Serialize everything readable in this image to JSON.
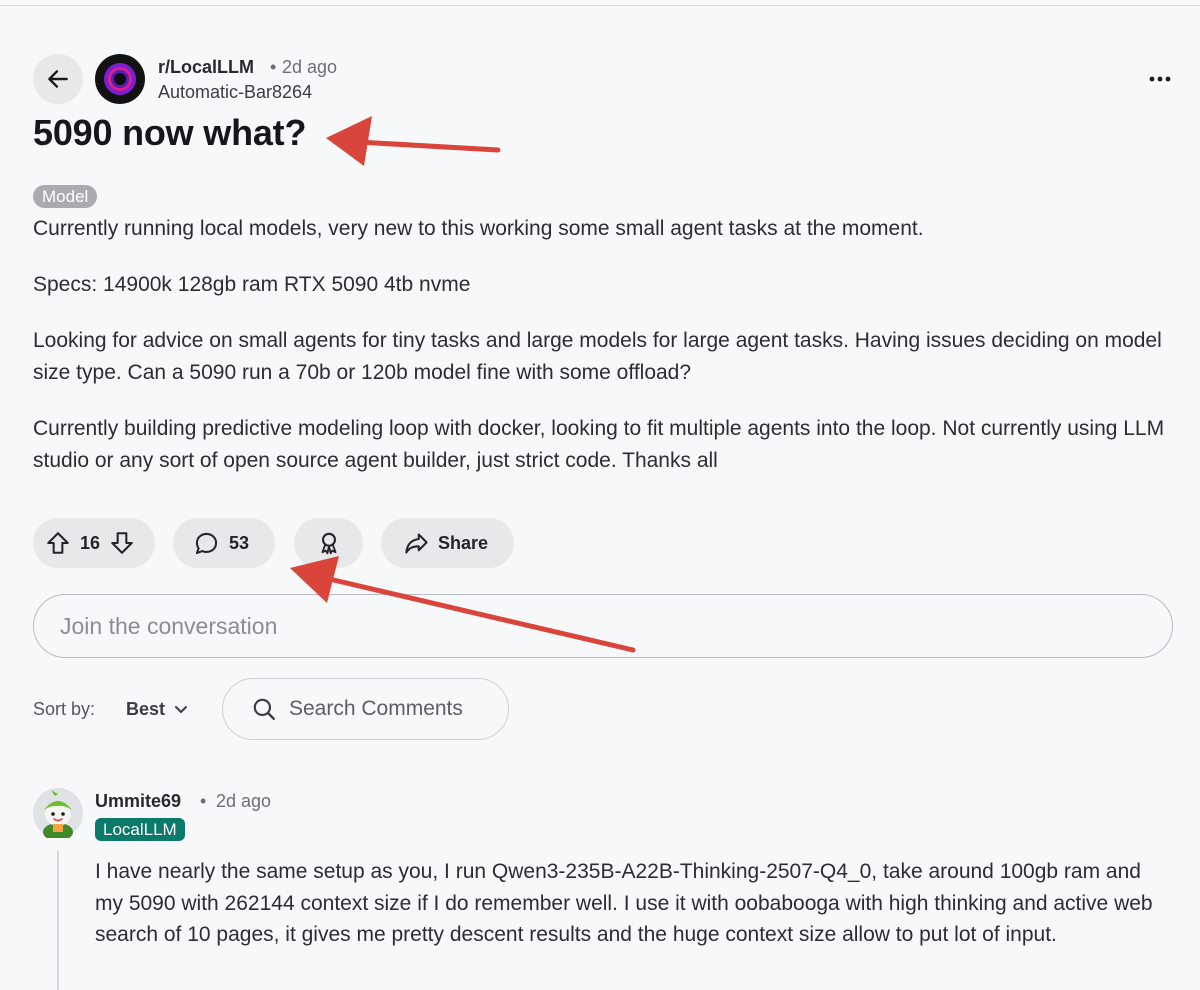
{
  "post": {
    "subreddit": "r/LocalLLM",
    "separator": "•",
    "age": "2d ago",
    "author": "Automatic-Bar8264",
    "title": "5090 now what?",
    "flair": "Model",
    "paragraphs": [
      "Currently running local models, very new to this working some small agent tasks at the moment.",
      "Specs: 14900k 128gb ram RTX 5090 4tb nvme",
      "Looking for advice on small agents for tiny tasks and large models for large agent tasks. Having issues deciding on model size type. Can a 5090 run a 70b or 120b model fine with some offload?",
      "Currently building predictive modeling loop with docker, looking to fit multiple agents into the loop. Not currently using LLM studio or any sort of open source agent builder, just strict code. Thanks all"
    ]
  },
  "actions": {
    "vote_count": "16",
    "comment_count": "53",
    "share_label": "Share"
  },
  "composer": {
    "placeholder": "Join the conversation"
  },
  "sort": {
    "label": "Sort by:",
    "value": "Best"
  },
  "search": {
    "placeholder": "Search Comments"
  },
  "comment": {
    "author": "Ummite69",
    "separator": "•",
    "age": "2d ago",
    "flair": "LocalLLM",
    "flair_color": "#0b7a6a",
    "text": "I have nearly the same setup as you, I run Qwen3-235B-A22B-Thinking-2507-Q4_0, take around 100gb ram and my 5090 with 262144 context size if I do remember well. I use it with oobabooga with high thinking and active web search of 10 pages, it gives me pretty descent results and the huge context size allow to put lot of input."
  },
  "annotations": {
    "arrow_color": "#d9453a"
  },
  "icons": [
    "arrow-left-icon",
    "subreddit-avatar",
    "more-icon",
    "upvote-icon",
    "downvote-icon",
    "comment-icon",
    "award-icon",
    "share-icon",
    "chevron-down-icon",
    "search-icon",
    "user-avatar"
  ]
}
